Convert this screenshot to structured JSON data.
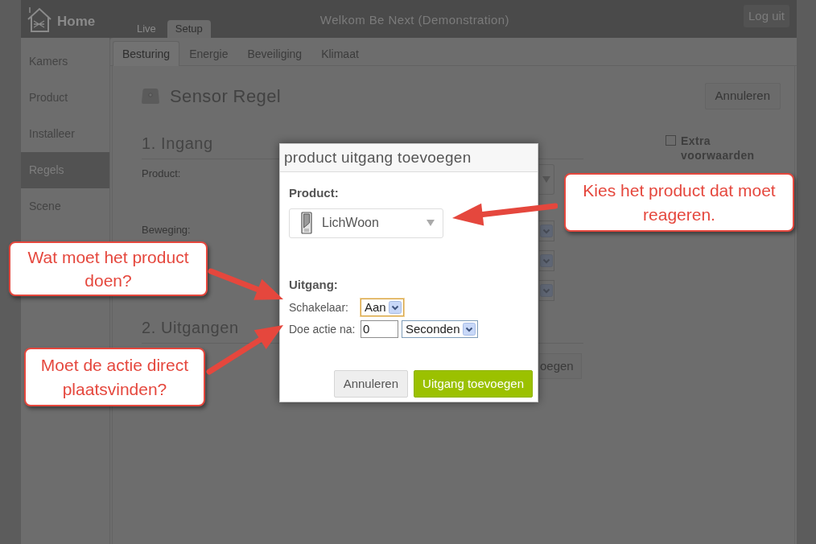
{
  "header": {
    "logo": "Home",
    "tabs": [
      {
        "label": "Live",
        "selected": false
      },
      {
        "label": "Setup",
        "selected": true
      }
    ],
    "welcome": "Welkom Be Next (Demonstration)",
    "logout_button": "Log uit"
  },
  "sidebar": {
    "items": [
      {
        "label": "Kamers",
        "selected": false
      },
      {
        "label": "Product",
        "selected": false
      },
      {
        "label": "Installeer",
        "selected": false
      },
      {
        "label": "Regels",
        "selected": true
      },
      {
        "label": "Scene",
        "selected": false
      }
    ]
  },
  "subtabs": [
    {
      "label": "Besturing",
      "selected": true
    },
    {
      "label": "Energie",
      "selected": false
    },
    {
      "label": "Beveiliging",
      "selected": false
    },
    {
      "label": "Klimaat",
      "selected": false
    }
  ],
  "rule": {
    "title": "Sensor Regel",
    "cancel_button": "Annuleren",
    "input_section": {
      "heading": "1. Ingang",
      "fields": [
        {
          "label": "Product:",
          "kind": "combo"
        },
        {
          "label": "Beweging:",
          "kind": "select"
        },
        {
          "kind": "select"
        },
        {
          "kind": "select"
        }
      ]
    },
    "output_section": {
      "heading": "2. Uitgangen",
      "button": "oegen"
    },
    "extra_conditions": {
      "label": "Extra voorwaarden",
      "checked": false
    }
  },
  "dialog": {
    "title": "product uitgang toevoegen",
    "product_label": "Product:",
    "product_select": {
      "value": "LichWoon"
    },
    "output_label": "Uitgang:",
    "switch": {
      "label": "Schakelaar:",
      "value": "Aan",
      "focused": true
    },
    "delay": {
      "label": "Doe actie na:",
      "value": "0",
      "unit": "Seconden"
    },
    "buttons": [
      {
        "label": "Annuleren",
        "kind": "secondary"
      },
      {
        "label": "Uitgang toevoegen",
        "kind": "primary"
      }
    ]
  },
  "callouts": [
    {
      "text": "Kies het product dat moet reageren."
    },
    {
      "text": "Wat moet het product doen?"
    },
    {
      "text": "Moet de actie direct plaatsvinden?"
    }
  ]
}
